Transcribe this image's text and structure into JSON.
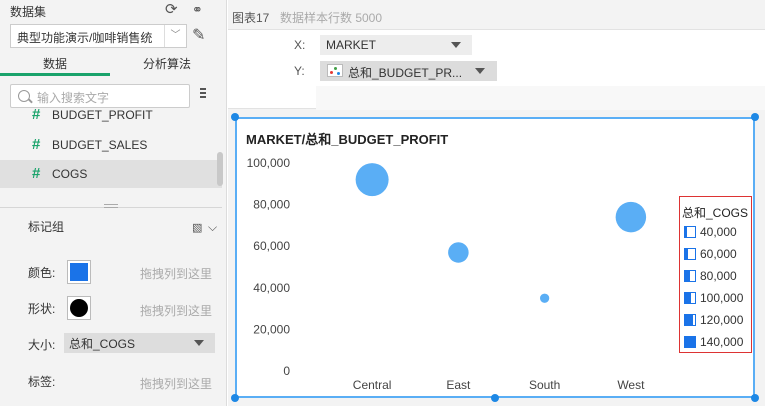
{
  "left": {
    "dataset_label": "数据集",
    "dataset_value": "典型功能演示/咖啡销售统",
    "tabs": [
      "数据",
      "分析算法"
    ],
    "search_placeholder": "输入搜索文字",
    "fields": [
      "BUDGET_PROFIT",
      "BUDGET_SALES",
      "COGS"
    ],
    "marks": {
      "title": "标记组",
      "color_label": "颜色:",
      "shape_label": "形状:",
      "size_label": "大小:",
      "tag_label": "标签:",
      "drop_hint": "拖拽列到这里",
      "size_value": "总和_COGS",
      "color": "#1a73e8"
    }
  },
  "right": {
    "chart_name": "图表17",
    "row_count": "数据样本行数 5000",
    "x_label": "X:",
    "x_field": "MARKET",
    "y_label": "Y:",
    "y_field": "总和_BUDGET_PR..."
  },
  "chart_data": {
    "type": "scatter",
    "title": "MARKET/总和_BUDGET_PROFIT",
    "categories": [
      "Central",
      "East",
      "South",
      "West"
    ],
    "y_ticks": [
      "100,000",
      "80,000",
      "60,000",
      "40,000",
      "20,000",
      "0"
    ],
    "ylim": [
      0,
      100000
    ],
    "values": [
      92000,
      57000,
      35000,
      74000
    ],
    "size_values": [
      120000,
      70000,
      25000,
      110000
    ],
    "bubble_color": "#5aaef5",
    "legend_title": "总和_COGS",
    "legend_items": [
      "40,000",
      "60,000",
      "80,000",
      "100,000",
      "120,000",
      "140,000"
    ],
    "legend_fill": [
      0.15,
      0.3,
      0.45,
      0.6,
      0.8,
      1.0
    ],
    "grid": false
  }
}
